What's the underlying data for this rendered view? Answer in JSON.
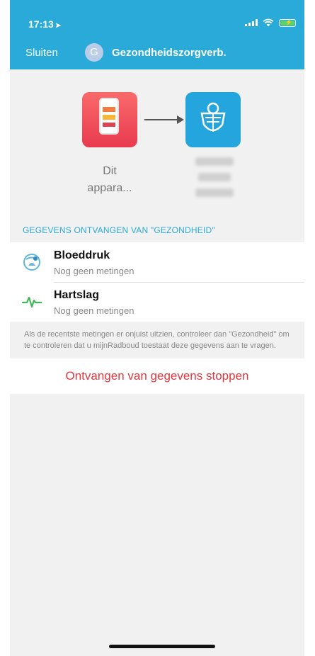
{
  "status_bar": {
    "time": "17:13",
    "location_arrow": "➤",
    "battery_color": "#5cd36a"
  },
  "nav": {
    "close_label": "Sluiten",
    "avatar_letter": "G",
    "title": "Gezondheidszorgverb."
  },
  "connection": {
    "device_label_line1": "Dit",
    "device_label_line2": "appara...",
    "source_icon": "apple-health-icon",
    "target_icon": "radboud-crest-icon"
  },
  "data_section": {
    "header": "GEGEVENS ONTVANGEN VAN \"GEZONDHEID\"",
    "items": [
      {
        "name": "Bloeddruk",
        "status": "Nog geen metingen",
        "icon": "blood-pressure-icon"
      },
      {
        "name": "Hartslag",
        "status": "Nog geen metingen",
        "icon": "heartbeat-icon"
      }
    ],
    "note": "Als de recentste metingen er onjuist uitzien, controleer dan \"Gezondheid\" om te controleren dat u mijnRadboud toestaat deze gegevens aan te vragen."
  },
  "actions": {
    "stop_label": "Ontvangen van gegevens stoppen"
  },
  "colors": {
    "accent": "#2aaad8",
    "destructive": "#e0383e",
    "background": "#f2f1f2"
  }
}
